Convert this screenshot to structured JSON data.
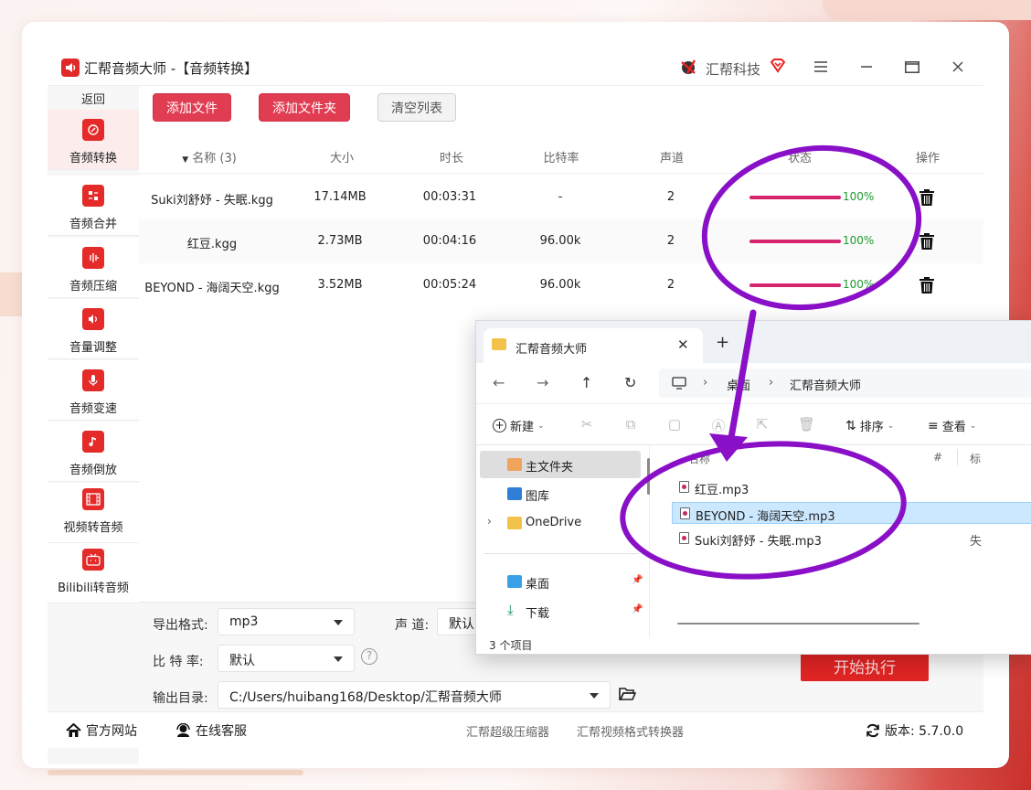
{
  "app": {
    "title": "汇帮音频大师  -【音频转换】",
    "brand": "汇帮科技"
  },
  "sidebar": {
    "back": "返回",
    "items": [
      {
        "label": "音频转换",
        "active": true
      },
      {
        "label": "音频合并"
      },
      {
        "label": "音频压缩"
      },
      {
        "label": "音量调整"
      },
      {
        "label": "音频变速"
      },
      {
        "label": "音频倒放"
      },
      {
        "label": "视频转音频"
      },
      {
        "label": "Bilibili转音频"
      }
    ]
  },
  "toolbar": {
    "add_file": "添加文件",
    "add_folder": "添加文件夹",
    "clear_list": "清空列表"
  },
  "table": {
    "headers": {
      "name": "名称 (3)",
      "size": "大小",
      "duration": "时长",
      "bitrate": "比特率",
      "channels": "声道",
      "status": "状态",
      "action": "操作"
    },
    "rows": [
      {
        "name": "Suki刘舒妤 - 失眠.kgg",
        "size": "17.14MB",
        "duration": "00:03:31",
        "bitrate": "-",
        "channels": "2",
        "progress": 1.0,
        "progress_text": "100%"
      },
      {
        "name": "红豆.kgg",
        "size": "2.73MB",
        "duration": "00:04:16",
        "bitrate": "96.00k",
        "channels": "2",
        "progress": 1.0,
        "progress_text": "100%"
      },
      {
        "name": "BEYOND - 海阔天空.kgg",
        "size": "3.52MB",
        "duration": "00:05:24",
        "bitrate": "96.00k",
        "channels": "2",
        "progress": 1.0,
        "progress_text": "100%"
      }
    ]
  },
  "settings": {
    "format_label": "导出格式:",
    "format_value": "mp3",
    "channel_label": "声  道:",
    "channel_value": "默认",
    "bitrate_label": "比 特 率:",
    "bitrate_value": "默认",
    "help": "?",
    "output_label": "输出目录:",
    "output_value": "C:/Users/huibang168/Desktop/汇帮音频大师",
    "start": "开始执行"
  },
  "footer": {
    "website": "官方网站",
    "support": "在线客服",
    "compressor": "汇帮超级压缩器",
    "video_converter": "汇帮视频格式转换器",
    "version": "版本:  5.7.0.0"
  },
  "explorer": {
    "tab_title": "汇帮音频大师",
    "tab_close": "✕",
    "new_tab": "+",
    "breadcrumb": [
      "桌面",
      "汇帮音频大师"
    ],
    "commands": {
      "new": "新建",
      "sort": "排序",
      "view": "查看"
    },
    "nav": [
      {
        "label": "主文件夹",
        "selected": true
      },
      {
        "label": "图库"
      },
      {
        "label": "OneDrive"
      },
      {
        "label": "桌面"
      },
      {
        "label": "下载"
      }
    ],
    "columns": {
      "name": "名称",
      "number": "#",
      "title": "标"
    },
    "files": [
      {
        "name": "红豆.mp3"
      },
      {
        "name": "BEYOND - 海阔天空.mp3",
        "selected": true
      },
      {
        "name": "Suki刘舒妤 - 失眠.mp3",
        "extra": "失"
      }
    ],
    "status": "3 个项目"
  },
  "colors": {
    "accent_red": "#e03c52",
    "progress": "#d6246e",
    "progress_text": "#1a9a2e",
    "annotation": "#8a10c8"
  }
}
